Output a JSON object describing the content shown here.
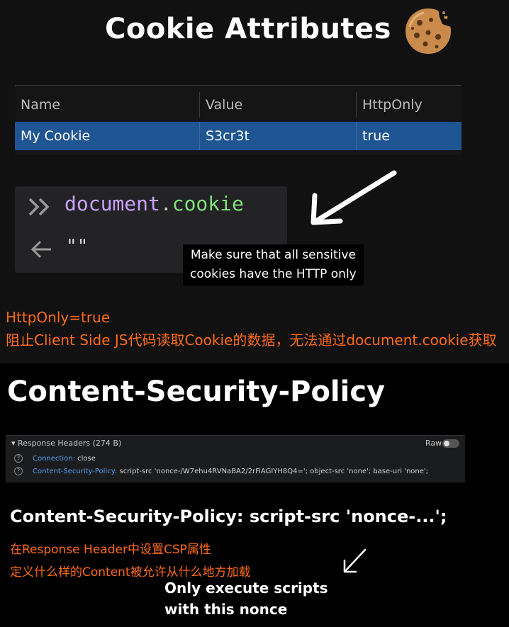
{
  "section1": {
    "title": "Cookie Attributes",
    "table": {
      "headers": [
        "Name",
        "Value",
        "HttpOnly"
      ],
      "row": [
        "My Cookie",
        "S3cr3t",
        "true"
      ]
    },
    "console": {
      "command_object": "document",
      "command_dot": ".",
      "command_property": "cookie",
      "result": "\"\""
    },
    "caption_lines": [
      "Make sure that all sensitive",
      "cookies have the HTTP only"
    ],
    "notes": [
      "HttpOnly=true",
      "阻止Client Side JS代码读取Cookie的数据，无法通过document.cookie获取"
    ]
  },
  "section2": {
    "title": "Content-Security-Policy",
    "response_headers": {
      "title": "Response Headers (274 B)",
      "raw_label": "Raw",
      "raw_enabled": false,
      "rows": [
        {
          "key": "Connection:",
          "value": "close"
        },
        {
          "key": "Content-Security-Policy:",
          "value": "script-src 'nonce-/W7ehu4RVNaBA2/2rFiAGIYH8Q4='; object-src 'none'; base-uri 'none';"
        }
      ]
    },
    "csp_example": "Content-Security-Policy: script-src 'nonce-...';",
    "notes": [
      "在Response Header中设置CSP属性",
      "定义什么样的Content被允许从什么地方加载"
    ],
    "callout_lines": [
      "Only execute scripts",
      "with this nonce"
    ]
  },
  "colors": {
    "accent_orange": "#ff6a1a",
    "selected_row": "#1f5592",
    "console_object": "#c9a0ff",
    "console_property": "#7fe07a",
    "link_blue": "#4f9cf0"
  }
}
